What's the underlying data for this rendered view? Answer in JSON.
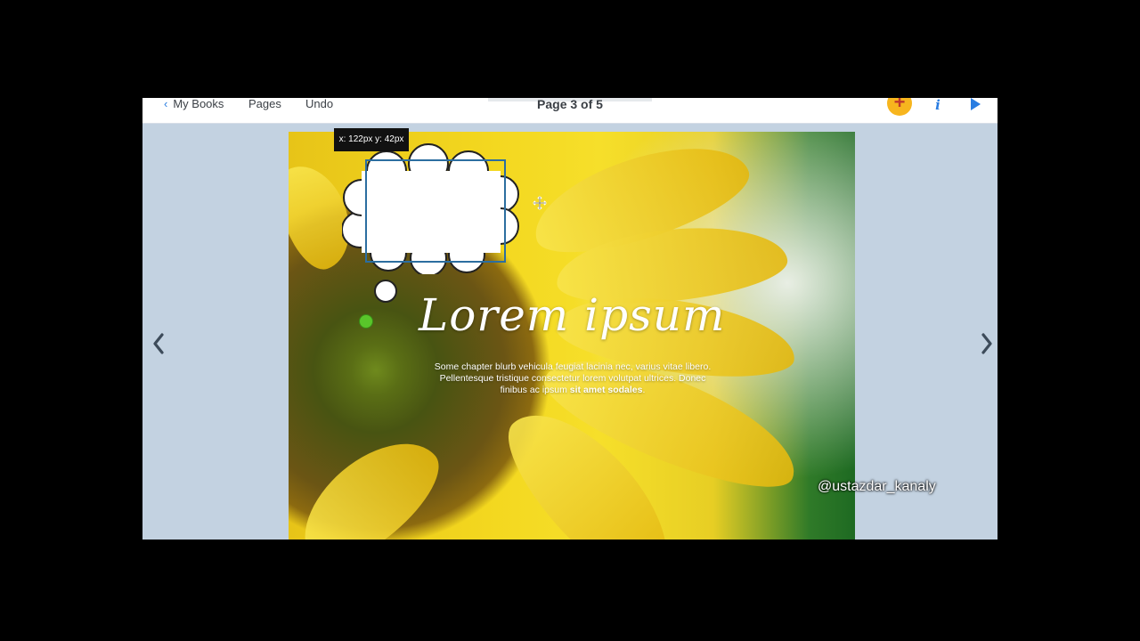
{
  "toolbar": {
    "back_label": "My Books",
    "pages_label": "Pages",
    "undo_label": "Undo",
    "page_indicator": "Page 3 of 5",
    "add_icon": "+",
    "info_icon": "i"
  },
  "editor": {
    "coord_readout": "x: 122px y: 42px",
    "headline": "Lorem ipsum",
    "blurb_text": "Some chapter blurb vehicula feugiat lacinia nec, varius vitae libero. Pellentesque tristique consectetur lorem volutpat ultrices. Donec finibus ac ipsum ",
    "blurb_bold": "sit amet sodales",
    "blurb_end": "."
  },
  "watermark": "@ustazdar_kanaly",
  "colors": {
    "accent": "#2a7de1",
    "add_button": "#f7b51e",
    "handle": "#59c52a",
    "selection": "#2c6ea0",
    "app_background": "#c3d2e1"
  }
}
